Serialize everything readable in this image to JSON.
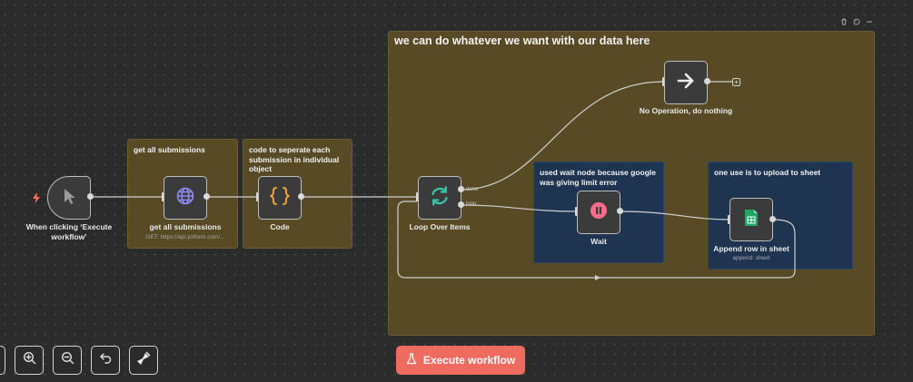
{
  "sticky_notes": {
    "main": "we can do whatever we want with our data here",
    "get_submissions": "get all submissions",
    "code_note": "code to seperate each submission in individual object",
    "wait_note": "used wait node because google was giving limit error",
    "sheet_note": "one use is to upload to sheet"
  },
  "nodes": {
    "trigger": {
      "label": "When clicking ‘Execute workflow’"
    },
    "http": {
      "label": "get all submissions",
      "subtitle": "GET: https://api.jotform.com/..."
    },
    "code": {
      "label": "Code"
    },
    "loop": {
      "label": "Loop Over Items"
    },
    "noop": {
      "label": "No Operation, do nothing"
    },
    "wait": {
      "label": "Wait"
    },
    "sheet": {
      "label": "Append row in sheet",
      "subtitle": "append: sheet"
    }
  },
  "edge_labels": {
    "done": "done",
    "loop": "loop"
  },
  "toolbar": {
    "execute_label": "Execute workflow"
  },
  "colors": {
    "canvas": "#2b2b2b",
    "sticky_yellow": "#574a24",
    "sticky_blue": "#1e3451",
    "accent": "#ef6b60",
    "trigger_bolt": "#ff6b5b",
    "http_globe": "#8f8cf5",
    "code_braces": "#f2a33a",
    "loop_arrows": "#39c3a5",
    "wait_pause": "#ff6d8a",
    "sheet_green": "#23a566"
  },
  "icons": [
    "bolt-icon",
    "cursor-icon",
    "globe-icon",
    "braces-icon",
    "refresh-icon",
    "arrow-right-icon",
    "pause-icon",
    "spreadsheet-icon",
    "zoom-in-icon",
    "zoom-out-icon",
    "undo-icon",
    "broom-icon",
    "flask-icon",
    "trash-icon",
    "palette-icon",
    "minus-icon"
  ]
}
